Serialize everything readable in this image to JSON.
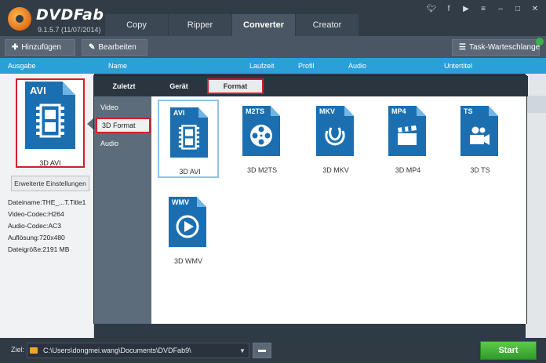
{
  "app": {
    "brand": "DVDFab",
    "version": "9.1.5.7 (11/07/2014)"
  },
  "tabs": [
    {
      "label": "Copy"
    },
    {
      "label": "Ripper"
    },
    {
      "label": "Converter",
      "active": true
    },
    {
      "label": "Creator"
    }
  ],
  "social_icons": [
    "twitter-icon",
    "facebook-icon",
    "youtube-icon",
    "menu-icon",
    "minimize-icon",
    "maximize-icon",
    "close-icon"
  ],
  "toolbar": {
    "add_label": "Hinzufügen",
    "edit_label": "Bearbeiten",
    "queue_label": "Task-Warteschlange"
  },
  "columns": {
    "ausgabe": "Ausgabe",
    "name": "Name",
    "laufzeit": "Laufzeit",
    "profil": "Profil",
    "audio": "Audio",
    "untertitel": "Untertitel"
  },
  "left_panel": {
    "format_tag": "AVI",
    "format_label": "3D AVI",
    "advanced_button": "Erweiterte Einstellungen",
    "info": {
      "dateiname": "Dateiname:THE_...T.Title1",
      "video_codec": "Video-Codec:H264",
      "audio_codec": "Audio-Codec:AC3",
      "aufloesung": "Auflösung:720x480",
      "dateigroesse": "Dateigröße:2191 MB"
    }
  },
  "popup": {
    "tabs": {
      "recent": "Zuletzt",
      "device": "Gerät",
      "format": "Format"
    },
    "categories": {
      "video": "Video",
      "format3d": "3D Format",
      "audio": "Audio"
    },
    "formats": [
      {
        "tag": "AVI",
        "label": "3D AVI",
        "icon": "film-strip-icon",
        "selected": true
      },
      {
        "tag": "M2TS",
        "label": "3D M2TS",
        "icon": "film-reel-icon"
      },
      {
        "tag": "MKV",
        "label": "3D MKV",
        "icon": "matroska-icon"
      },
      {
        "tag": "MP4",
        "label": "3D MP4",
        "icon": "clapperboard-icon"
      },
      {
        "tag": "TS",
        "label": "3D TS",
        "icon": "video-camera-icon"
      },
      {
        "tag": "WMV",
        "label": "3D WMV",
        "icon": "play-icon"
      }
    ]
  },
  "bottom": {
    "ziel_label": "Ziel:",
    "path": "C:\\Users\\dongmei.wang\\Documents\\DVDFab9\\",
    "start_label": "Start"
  },
  "colors": {
    "accent_blue": "#2a9fd8",
    "icon_blue": "#1b6fb1",
    "highlight_red": "#d0202b",
    "start_green": "#3aa832"
  }
}
